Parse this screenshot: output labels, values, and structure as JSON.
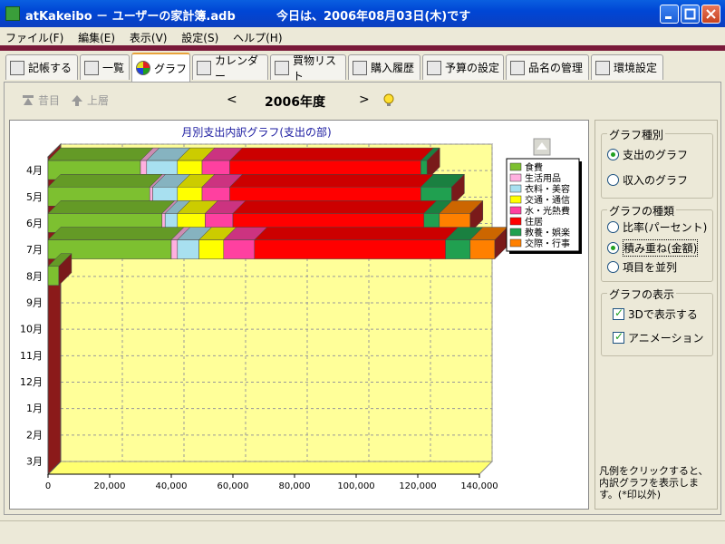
{
  "window": {
    "title": "atKakeibo － ユーザーの家計簿.adb",
    "date_text": "今日は、2006年08月03日(木)です"
  },
  "menu": [
    "ファイル(F)",
    "編集(E)",
    "表示(V)",
    "設定(S)",
    "ヘルプ(H)"
  ],
  "tabs": [
    {
      "label": "記帳する",
      "active": false
    },
    {
      "label": "一覧",
      "active": false
    },
    {
      "label": "グラフ",
      "active": true
    },
    {
      "label": "カレンダー",
      "active": false
    },
    {
      "label": "買物リスト",
      "active": false
    },
    {
      "label": "購入履歴",
      "active": false
    },
    {
      "label": "予算の設定",
      "active": false
    },
    {
      "label": "品名の管理",
      "active": false
    },
    {
      "label": "環境設定",
      "active": false
    }
  ],
  "nav": {
    "prev_year_label": "昔目",
    "up_label": "上層",
    "prev_arrow": "<",
    "year_label": "2006年度",
    "next_arrow": ">"
  },
  "right_panel": {
    "graph_type_title": "グラフ種別",
    "graph_type_options": [
      {
        "label": "支出のグラフ",
        "selected": true
      },
      {
        "label": "収入のグラフ",
        "selected": false
      }
    ],
    "graph_kind_title": "グラフの種類",
    "graph_kind_options": [
      {
        "label": "比率(パーセント)",
        "selected": false
      },
      {
        "label": "積み重ね(金額)",
        "selected": true
      },
      {
        "label": "項目を並列",
        "selected": false
      }
    ],
    "display_title": "グラフの表示",
    "display_options": [
      {
        "label": "3Dで表示する",
        "checked": true
      },
      {
        "label": "アニメーション",
        "checked": true
      }
    ],
    "note": "凡例をクリックすると、内訳グラフを表示します。(*印以外)"
  },
  "colors": {
    "chart_bg": "#ffff99",
    "chart_side": "#8b1a1a",
    "legend_border": "#000000"
  },
  "chart_data": {
    "type": "bar",
    "orientation": "horizontal-stacked-3d",
    "title": "月別支出内訳グラフ(支出の部)",
    "categories": [
      "4月",
      "5月",
      "6月",
      "7月",
      "8月",
      "9月",
      "10月",
      "11月",
      "12月",
      "1月",
      "2月",
      "3月"
    ],
    "xlim": [
      0,
      140000
    ],
    "xticks": [
      "0",
      "20,000",
      "40,000",
      "60,000",
      "80,000",
      "100,000",
      "120,000",
      "140,000"
    ],
    "grid": true,
    "legend_position": "right",
    "series": [
      {
        "name": "食費",
        "color": "#7dc030",
        "values": [
          30000,
          33000,
          37000,
          40000,
          3500,
          0,
          0,
          0,
          0,
          0,
          0,
          0
        ]
      },
      {
        "name": "生活用品",
        "color": "#ffb0e0",
        "values": [
          2000,
          1000,
          1000,
          2000,
          0,
          0,
          0,
          0,
          0,
          0,
          0,
          0
        ]
      },
      {
        "name": "衣料・美容",
        "color": "#a8e0f0",
        "values": [
          10000,
          8000,
          4000,
          7000,
          0,
          0,
          0,
          0,
          0,
          0,
          0,
          0
        ]
      },
      {
        "name": "交通・通信",
        "color": "#ffff00",
        "values": [
          8000,
          8000,
          9000,
          8000,
          0,
          0,
          0,
          0,
          0,
          0,
          0,
          0
        ]
      },
      {
        "name": "水・光熱費",
        "color": "#ff40a0",
        "values": [
          9000,
          9000,
          9000,
          10000,
          0,
          0,
          0,
          0,
          0,
          0,
          0,
          0
        ]
      },
      {
        "name": "住居",
        "color": "#ff0000",
        "values": [
          62000,
          62000,
          62000,
          62000,
          0,
          0,
          0,
          0,
          0,
          0,
          0,
          0
        ]
      },
      {
        "name": "教養・娯楽",
        "color": "#20a050",
        "values": [
          2000,
          10000,
          5000,
          8000,
          0,
          0,
          0,
          0,
          0,
          0,
          0,
          0
        ]
      },
      {
        "name": "交際・行事",
        "color": "#ff8000",
        "values": [
          0,
          0,
          10000,
          8000,
          0,
          0,
          0,
          0,
          0,
          0,
          0,
          0
        ]
      }
    ]
  }
}
